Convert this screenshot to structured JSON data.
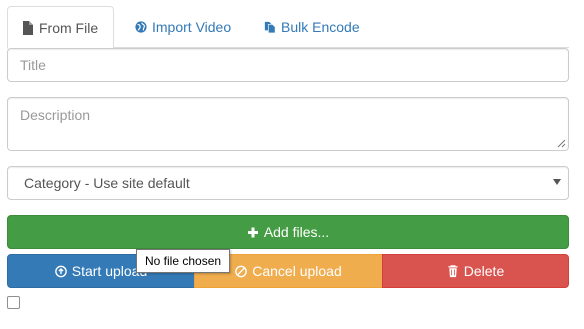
{
  "tabs": [
    {
      "label": "From File",
      "icon": "file-icon"
    },
    {
      "label": "Import Video",
      "icon": "globe-icon"
    },
    {
      "label": "Bulk Encode",
      "icon": "files-icon"
    }
  ],
  "form": {
    "title_placeholder": "Title",
    "description_placeholder": "Description",
    "category_selected": "Category - Use site default"
  },
  "buttons": {
    "add_files": "Add files...",
    "start_upload": "Start upload",
    "cancel_upload": "Cancel upload",
    "delete": "Delete"
  },
  "tooltip": "No file chosen",
  "colors": {
    "add": "#449d44",
    "start": "#337ab7",
    "cancel": "#f0ad4e",
    "delete": "#d9534f",
    "link": "#337ab7"
  }
}
